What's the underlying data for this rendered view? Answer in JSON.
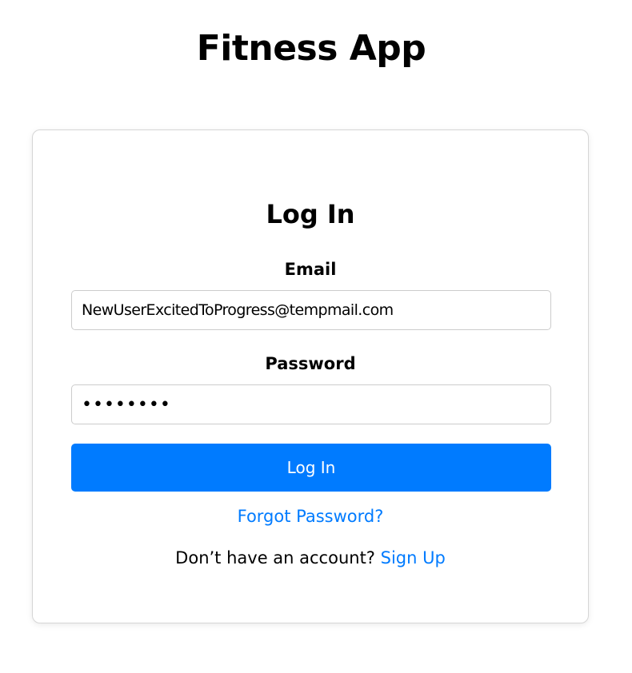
{
  "app": {
    "title": "Fitness App"
  },
  "login_form": {
    "title": "Log In",
    "email_label": "Email",
    "email_value": "NewUserExcitedToProgress@tempmail.com",
    "password_label": "Password",
    "password_value": "password",
    "submit_label": "Log In",
    "forgot_password_label": "Forgot Password?",
    "signup_prompt": "Don’t have an account?",
    "signup_link_label": "Sign Up"
  },
  "colors": {
    "accent": "#007bff",
    "card_border": "#d6d6d6",
    "input_border": "#cccccc"
  }
}
